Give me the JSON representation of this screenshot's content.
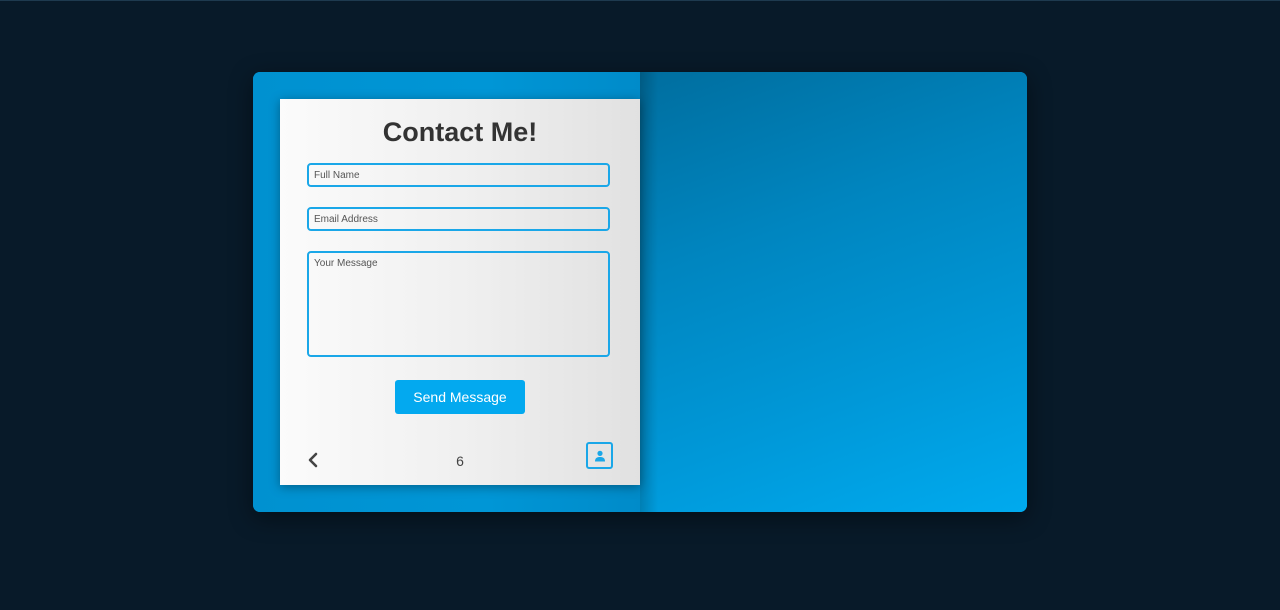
{
  "contact_page": {
    "title": "Contact Me!",
    "fields": {
      "full_name_placeholder": "Full Name",
      "email_placeholder": "Email Address",
      "message_placeholder": "Your Message"
    },
    "send_label": "Send Message",
    "page_number": "6"
  },
  "icons": {
    "back": "chevron-left-icon",
    "profile": "user-icon"
  },
  "colors": {
    "background": "#081a29",
    "book_blue": "#0096d6",
    "accent": "#03a9ef",
    "field_border": "#1aa7e8",
    "title_text": "#333333"
  }
}
